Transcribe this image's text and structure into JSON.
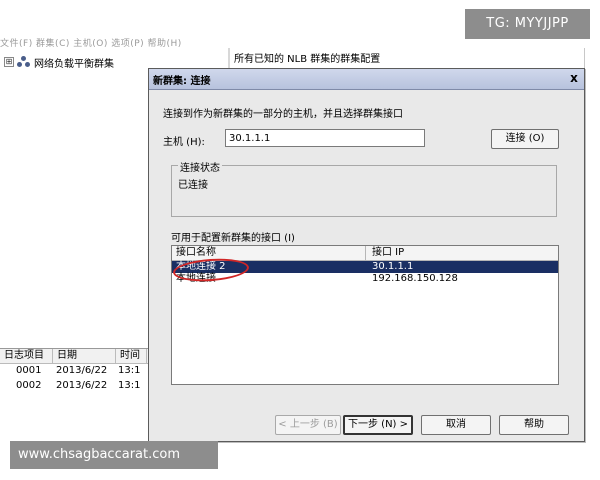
{
  "background_app": {
    "menubar_text": "文件(F)  群集(C)  主机(O)  选项(P)  帮助(H)",
    "tree": {
      "expander": "⊞",
      "icon": "cluster-icon",
      "label": "网络负载平衡群集"
    },
    "right_header": "所有已知的 NLB 群集的群集配置",
    "log": {
      "columns": [
        "日志项目",
        "日期",
        "时间"
      ],
      "rows": [
        {
          "id": "0001",
          "date": "2013/6/22",
          "time": "13:1"
        },
        {
          "id": "0002",
          "date": "2013/6/22",
          "time": "13:1"
        }
      ]
    }
  },
  "dialog": {
    "title": "新群集:  连接",
    "close_glyph": "x",
    "intro_text": "连接到作为新群集的一部分的主机，并且选择群集接口",
    "host_label": "主机 (H):",
    "host_value": "30.1.1.1",
    "connect_button": "连接 (O)",
    "status_group_label": "连接状态",
    "status_text": "已连接",
    "interfaces_caption": "可用于配置新群集的接口 (I)",
    "interface_columns": [
      "接口名称",
      "接口 IP"
    ],
    "interfaces": [
      {
        "name": "本地连接 2",
        "ip": "30.1.1.1",
        "selected": true
      },
      {
        "name": "本地连接",
        "ip": "192.168.150.128",
        "selected": false
      }
    ],
    "buttons": {
      "back": "< 上一步 (B)",
      "next": "下一步 (N) >",
      "cancel": "取消",
      "help": "帮助"
    }
  },
  "overlays": {
    "top_badge": "TG: MYYJJPP",
    "bottom_badge": "www.chsagbaccarat.com"
  },
  "colors": {
    "selection": "#1a2f63",
    "annotation_circle": "#d02626",
    "badge_background": "#8d8d8d"
  }
}
